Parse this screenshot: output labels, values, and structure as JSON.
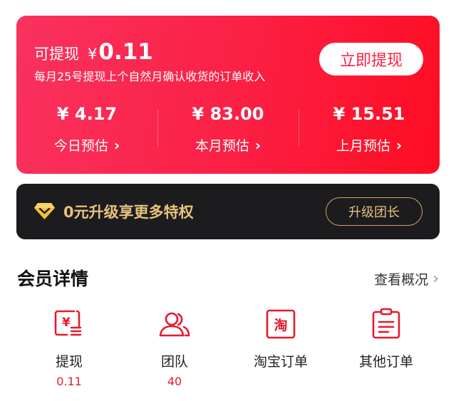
{
  "earnings": {
    "withdraw_label": "可提现",
    "currency": "¥",
    "withdraw_amount": "0.11",
    "withdraw_note": "每月25号提现上个自然月确认收货的订单收入",
    "withdraw_button": "立即提现",
    "stats": [
      {
        "value": "¥ 4.17",
        "label": "今日预估"
      },
      {
        "value": "¥ 83.00",
        "label": "本月预估"
      },
      {
        "value": "¥ 15.51",
        "label": "上月预估"
      }
    ]
  },
  "vip": {
    "text": "0元升级享更多特权",
    "button": "升级团长"
  },
  "member": {
    "title": "会员详情",
    "view_overview": "查看概况",
    "items": [
      {
        "label": "提现",
        "value": "0.11",
        "icon": "withdraw-icon"
      },
      {
        "label": "团队",
        "value": "40",
        "icon": "team-icon"
      },
      {
        "label": "淘宝订单",
        "value": "",
        "icon": "taobao-order-icon"
      },
      {
        "label": "其他订单",
        "value": "",
        "icon": "other-order-icon"
      }
    ]
  },
  "colors": {
    "accent_red": "#fb1f43",
    "gold": "#e7c27f",
    "dark_bar": "#1c1c1e"
  }
}
